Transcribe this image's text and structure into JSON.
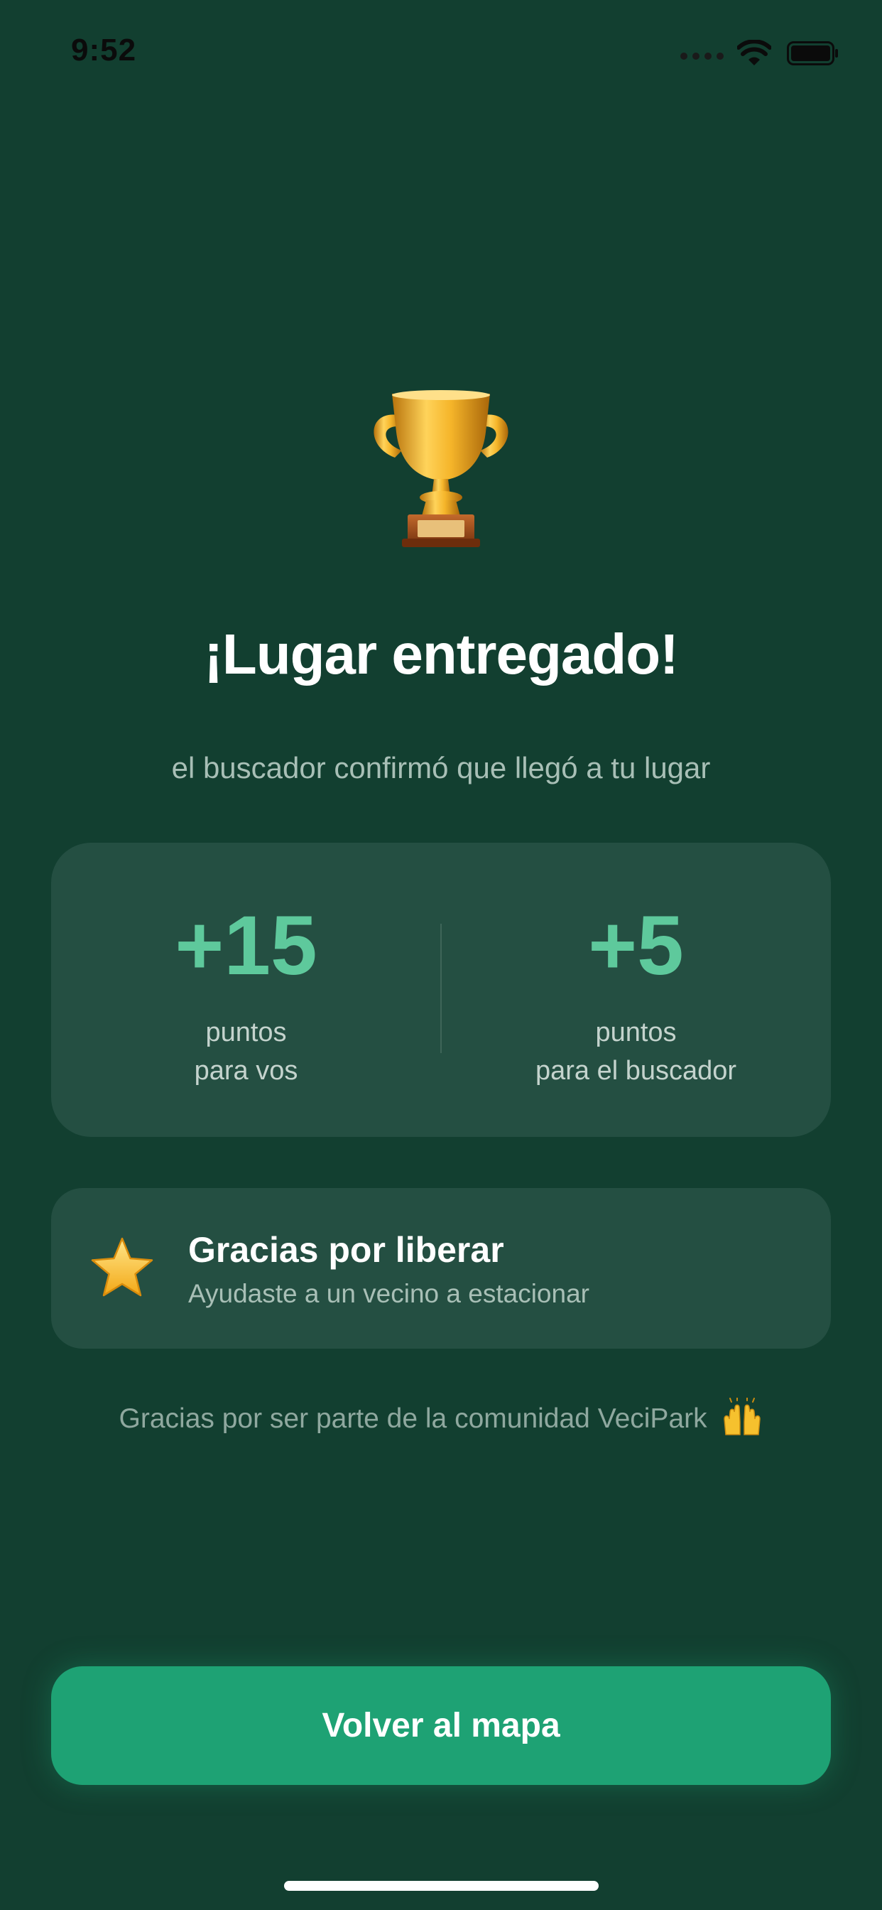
{
  "status_bar": {
    "time": "9:52"
  },
  "hero": {
    "icon": "trophy-icon",
    "title": "¡Lugar entregado!",
    "subtitle": "el buscador confirmó que llegó a tu lugar"
  },
  "points": {
    "you": {
      "value": "+15",
      "label_line1": "puntos",
      "label_line2": "para vos"
    },
    "finder": {
      "value": "+5",
      "label_line1": "puntos",
      "label_line2": "para el buscador"
    }
  },
  "thanks_card": {
    "icon": "star-icon",
    "title": "Gracias por liberar",
    "subtitle": "Ayudaste a un vecino a estacionar"
  },
  "footer": {
    "community_text": "Gracias por ser parte de la comunidad VeciPark",
    "community_icon": "raised-hands-icon"
  },
  "actions": {
    "back_to_map": "Volver al mapa"
  },
  "colors": {
    "background": "#123f30",
    "card": "#244f42",
    "accent": "#5ec99c",
    "button": "#1ea274"
  }
}
